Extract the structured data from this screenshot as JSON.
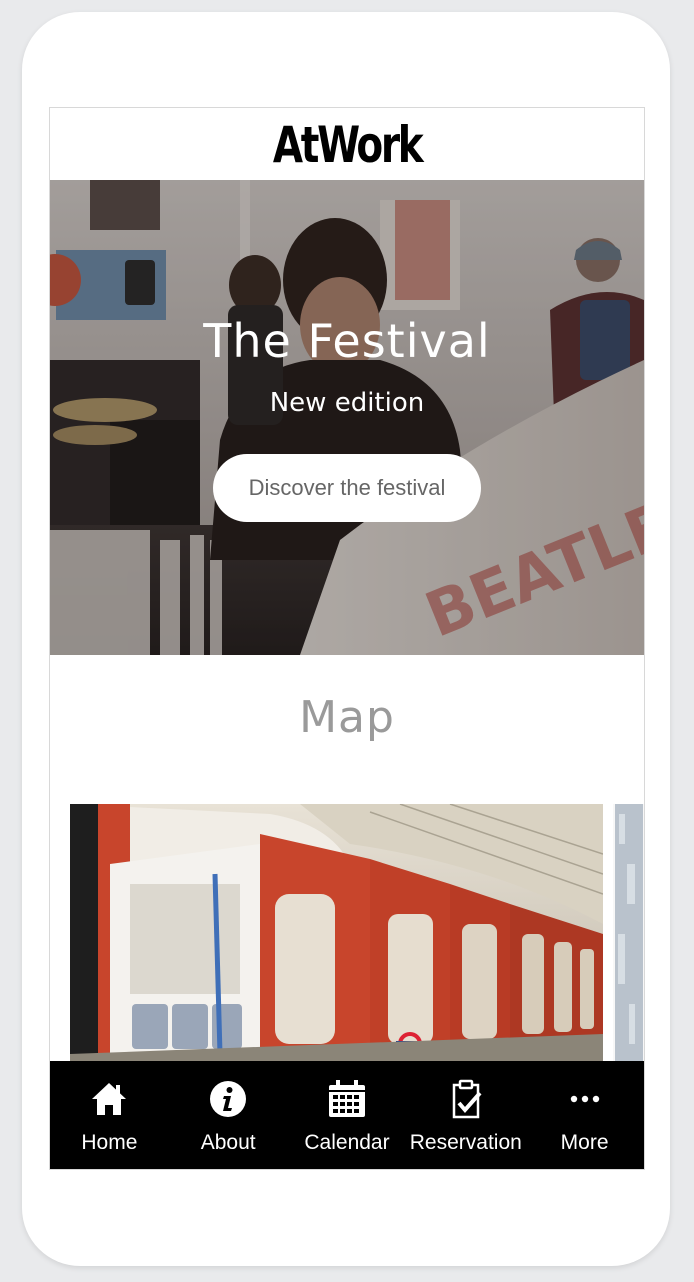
{
  "header": {
    "brand": "AtWork"
  },
  "hero": {
    "title": "The Festival",
    "subtitle": "New edition",
    "button_label": "Discover the festival"
  },
  "map_section": {
    "title": "Map"
  },
  "tabbar": {
    "tabs": [
      {
        "label": "Home",
        "icon": "home-icon"
      },
      {
        "label": "About",
        "icon": "info-icon"
      },
      {
        "label": "Calendar",
        "icon": "calendar-icon"
      },
      {
        "label": "Reservation",
        "icon": "clipboard-check-icon"
      },
      {
        "label": "More",
        "icon": "more-icon"
      }
    ]
  },
  "colors": {
    "tabbar_background": "#000000",
    "section_title": "#9a9a9a",
    "train_red": "#c8452c"
  }
}
